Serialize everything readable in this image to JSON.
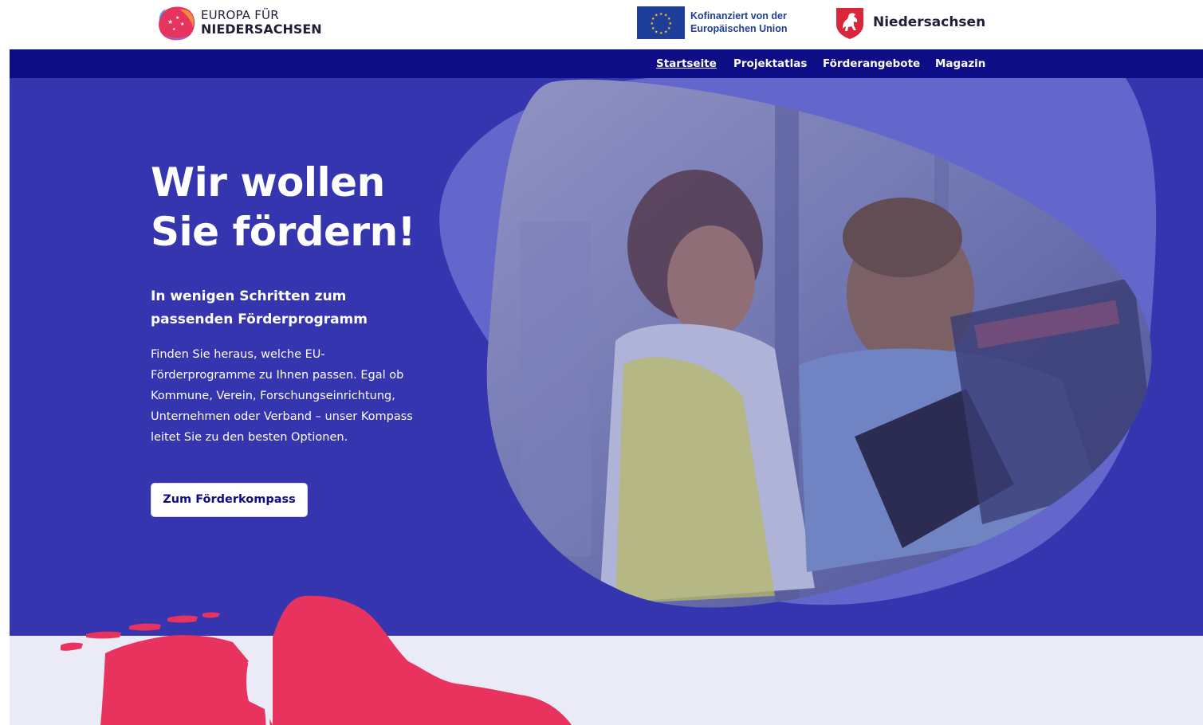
{
  "header": {
    "logo": {
      "line1": "EUROPA FÜR",
      "line2": "NIEDERSACHSEN"
    },
    "eu": {
      "line1": "Kofinanziert von der",
      "line2": "Europäischen Union"
    },
    "state": {
      "name": "Niedersachsen"
    }
  },
  "nav": {
    "items": [
      {
        "label": "Startseite",
        "active": true
      },
      {
        "label": "Projektatlas",
        "active": false
      },
      {
        "label": "Förderangebote",
        "active": false
      },
      {
        "label": "Magazin",
        "active": false
      }
    ]
  },
  "hero": {
    "title_line1": "Wir wollen",
    "title_line2": "Sie fördern!",
    "subtitle_line1": "In wenigen Schritten zum",
    "subtitle_line2": "passenden Förderprogramm",
    "body": "Finden Sie heraus, welche EU-Förderprogramme zu Ihnen passen. Egal ob Kommune, Verein, Forschungseinrichtung, Unternehmen oder Verband – unser Kompass leitet Sie zu den besten Optionen.",
    "cta_label": "Zum Förderkompass"
  },
  "colors": {
    "nav_bg": "#0d0d85",
    "hero_bg": "#3535b0",
    "accent_pink": "#e8335f",
    "eu_blue": "#1e3e99",
    "band_bg": "#ebebf7"
  },
  "icons": {
    "logo": "europa-fuer-niedersachsen-logo",
    "eu_flag": "eu-flag-icon",
    "state_emblem": "niedersachsen-horse-icon",
    "hero_image": "workers-photo",
    "map": "niedersachsen-map"
  }
}
